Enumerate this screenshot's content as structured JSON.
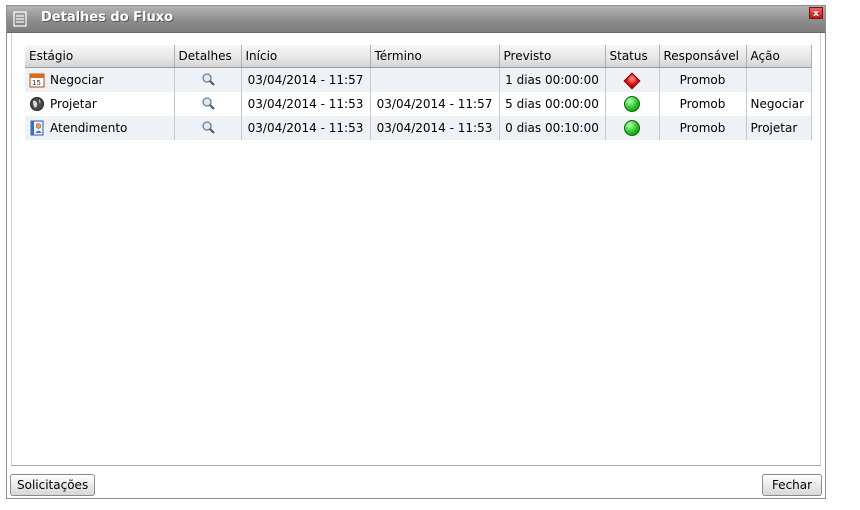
{
  "window": {
    "title": "Detalhes do Fluxo",
    "close_label": "x"
  },
  "table": {
    "headers": [
      "Estágio",
      "Detalhes",
      "Início",
      "Término",
      "Previsto",
      "Status",
      "Responsável",
      "Ação"
    ],
    "rows": [
      {
        "stage": "Negociar",
        "stage_icon": "calendar-icon",
        "details_icon": "magnifier-icon",
        "start": "03/04/2014 - 11:57",
        "end": "",
        "expected": "1 dias 00:00:00",
        "status": "red",
        "responsible": "Promob",
        "action": ""
      },
      {
        "stage": "Projetar",
        "stage_icon": "globe-icon",
        "details_icon": "magnifier-icon",
        "start": "03/04/2014 - 11:53",
        "end": "03/04/2014 - 11:57",
        "expected": "5 dias 00:00:00",
        "status": "green",
        "responsible": "Promob",
        "action": "Negociar"
      },
      {
        "stage": "Atendimento",
        "stage_icon": "contact-card-icon",
        "details_icon": "magnifier-icon",
        "start": "03/04/2014 - 11:53",
        "end": "03/04/2014 - 11:53",
        "expected": "0 dias 00:10:00",
        "status": "green",
        "responsible": "Promob",
        "action": "Projetar"
      }
    ]
  },
  "footer": {
    "left_button": "Solicitações",
    "right_button": "Fechar"
  },
  "colors": {
    "status_red": "#e01010",
    "status_green": "#26c026",
    "titlebar": "#8d8d8d"
  }
}
